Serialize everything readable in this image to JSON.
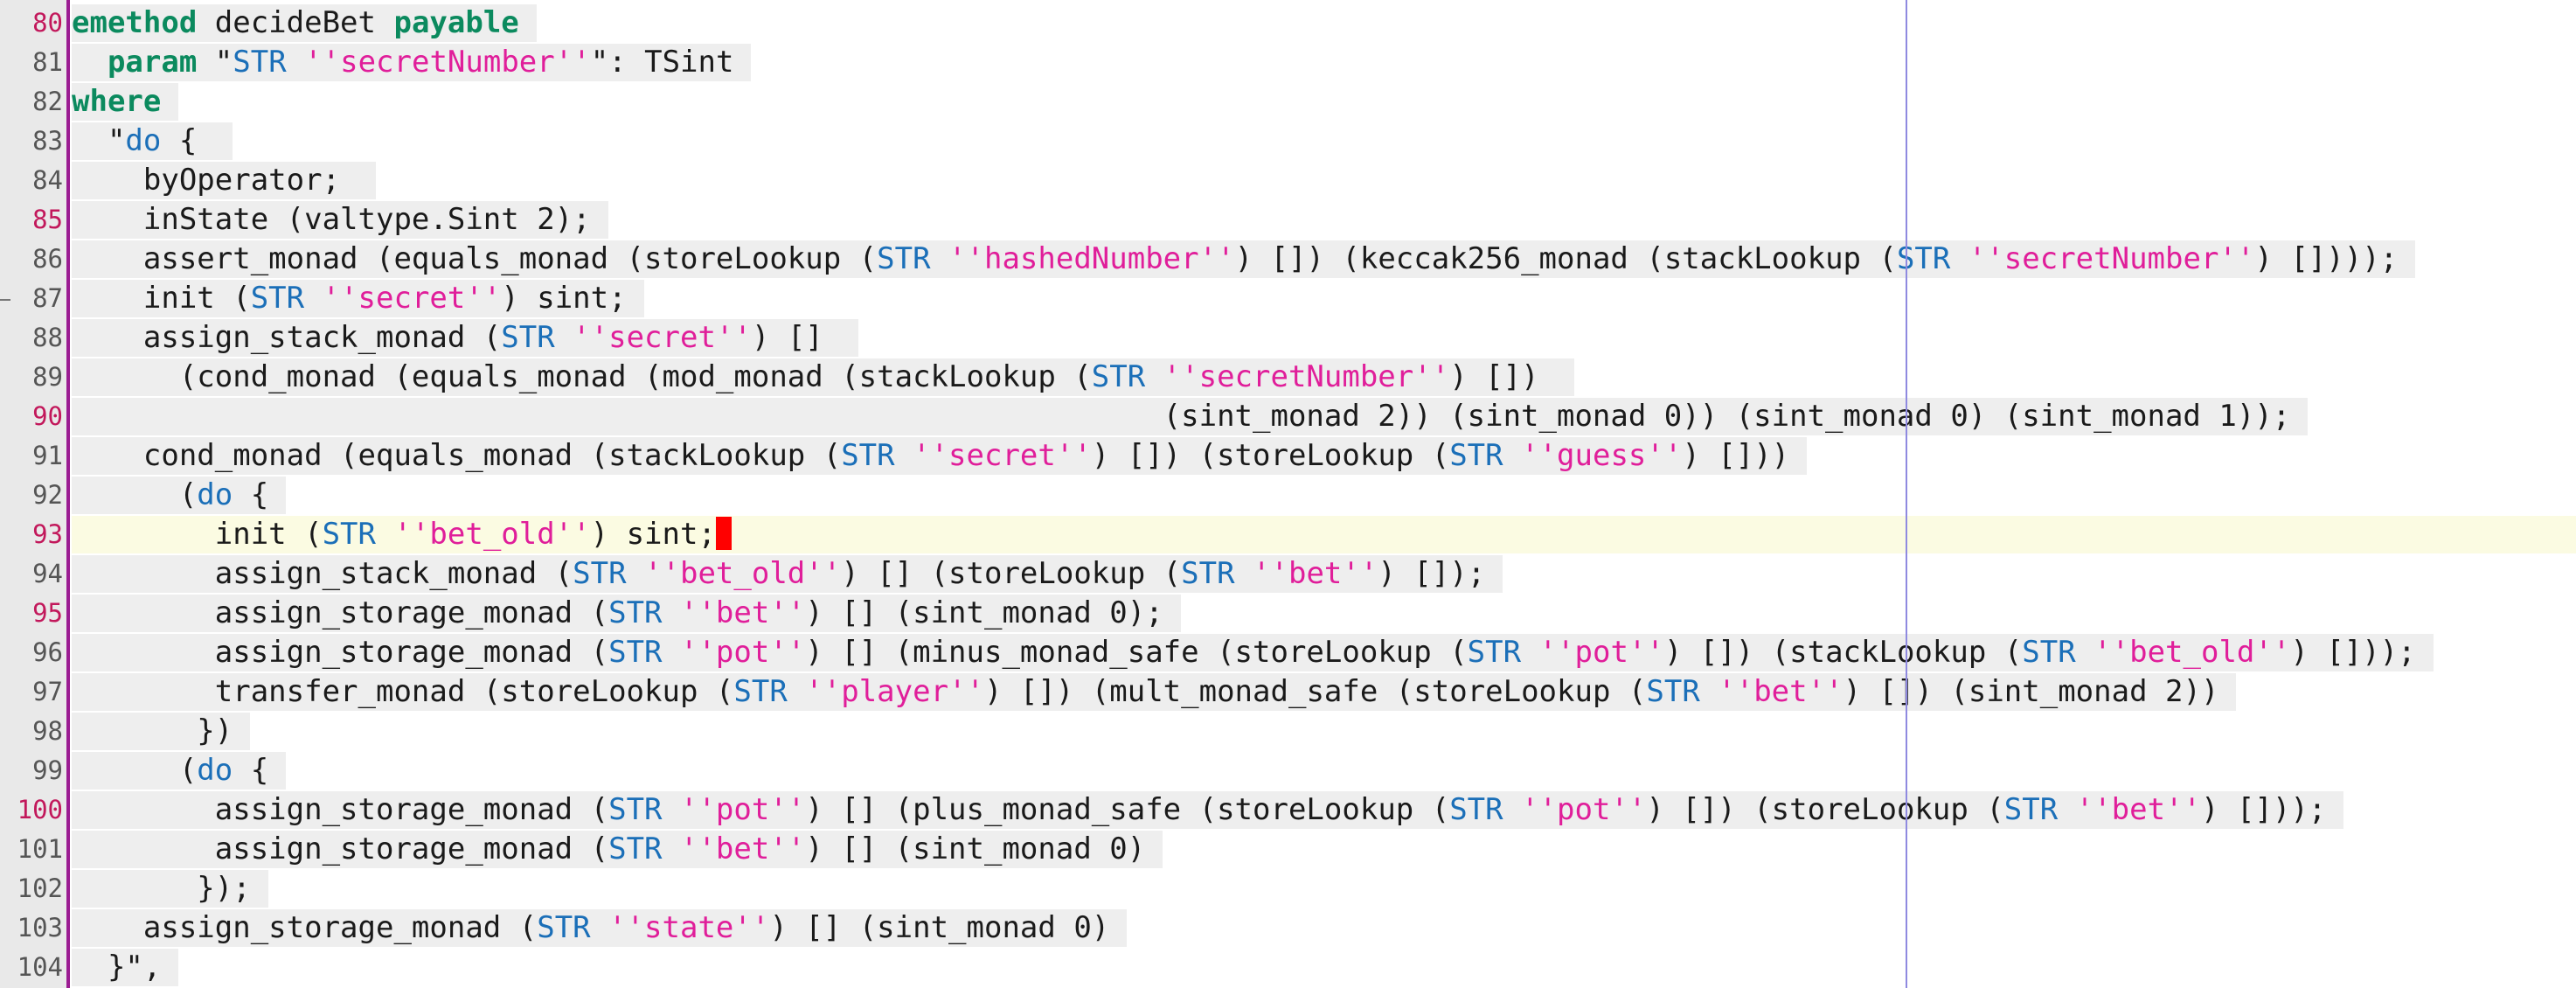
{
  "editor": {
    "current_line": "93",
    "lines": [
      {
        "num": "80",
        "tokens": [
          [
            "kw",
            "emethod"
          ],
          [
            "fn",
            " decideBet "
          ],
          [
            "kw",
            "payable"
          ]
        ]
      },
      {
        "num": "81",
        "tokens": [
          [
            "fn",
            "  "
          ],
          [
            "kw",
            "param"
          ],
          [
            "fn",
            " \""
          ],
          [
            "con",
            "STR"
          ],
          [
            "str",
            " ''secretNumber''"
          ],
          [
            "fn",
            "\": TSint"
          ]
        ]
      },
      {
        "num": "82",
        "tokens": [
          [
            "kw",
            "where"
          ]
        ]
      },
      {
        "num": "83",
        "tokens": [
          [
            "fn",
            "  \""
          ],
          [
            "con",
            "do"
          ],
          [
            "fn",
            " { "
          ]
        ]
      },
      {
        "num": "84",
        "tokens": [
          [
            "fn",
            "    byOperator; "
          ]
        ]
      },
      {
        "num": "85",
        "tokens": [
          [
            "fn",
            "    inState (valtype.Sint 2);"
          ]
        ]
      },
      {
        "num": "86",
        "tokens": [
          [
            "fn",
            "    assert_monad (equals_monad (storeLookup ("
          ],
          [
            "con",
            "STR"
          ],
          [
            "str",
            " ''hashedNumber''"
          ],
          [
            "fn",
            ") []) (keccak256_monad (stackLookup ("
          ],
          [
            "con",
            "STR"
          ],
          [
            "str",
            " ''secretNumber''"
          ],
          [
            "fn",
            ") [])));"
          ]
        ]
      },
      {
        "num": "87",
        "tokens": [
          [
            "fn",
            "    init ("
          ],
          [
            "con",
            "STR"
          ],
          [
            "str",
            " ''secret''"
          ],
          [
            "fn",
            ") sint;"
          ]
        ]
      },
      {
        "num": "88",
        "tokens": [
          [
            "fn",
            "    assign_stack_monad ("
          ],
          [
            "con",
            "STR"
          ],
          [
            "str",
            " ''secret''"
          ],
          [
            "fn",
            ") [] "
          ]
        ]
      },
      {
        "num": "89",
        "tokens": [
          [
            "fn",
            "      (cond_monad (equals_monad (mod_monad (stackLookup ("
          ],
          [
            "con",
            "STR"
          ],
          [
            "str",
            " ''secretNumber''"
          ],
          [
            "fn",
            ") []) "
          ]
        ]
      },
      {
        "num": "90",
        "tokens": [
          [
            "fn",
            "                                                             (sint_monad 2)) (sint_monad 0)) (sint_monad 0) (sint_monad 1));"
          ]
        ]
      },
      {
        "num": "91",
        "tokens": [
          [
            "fn",
            "    cond_monad (equals_monad (stackLookup ("
          ],
          [
            "con",
            "STR"
          ],
          [
            "str",
            " ''secret''"
          ],
          [
            "fn",
            ") []) (storeLookup ("
          ],
          [
            "con",
            "STR"
          ],
          [
            "str",
            " ''guess''"
          ],
          [
            "fn",
            ") []))"
          ]
        ]
      },
      {
        "num": "92",
        "tokens": [
          [
            "fn",
            "      ("
          ],
          [
            "con",
            "do"
          ],
          [
            "fn",
            " {"
          ]
        ]
      },
      {
        "num": "93",
        "tokens": [
          [
            "fn",
            "        init ("
          ],
          [
            "con",
            "STR"
          ],
          [
            "str",
            " ''bet_old''"
          ],
          [
            "fn",
            ") sint;"
          ]
        ]
      },
      {
        "num": "94",
        "tokens": [
          [
            "fn",
            "        assign_stack_monad ("
          ],
          [
            "con",
            "STR"
          ],
          [
            "str",
            " ''bet_old''"
          ],
          [
            "fn",
            ") [] (storeLookup ("
          ],
          [
            "con",
            "STR"
          ],
          [
            "str",
            " ''bet''"
          ],
          [
            "fn",
            ") []);"
          ]
        ]
      },
      {
        "num": "95",
        "tokens": [
          [
            "fn",
            "        assign_storage_monad ("
          ],
          [
            "con",
            "STR"
          ],
          [
            "str",
            " ''bet''"
          ],
          [
            "fn",
            ") [] (sint_monad 0);"
          ]
        ]
      },
      {
        "num": "96",
        "tokens": [
          [
            "fn",
            "        assign_storage_monad ("
          ],
          [
            "con",
            "STR"
          ],
          [
            "str",
            " ''pot''"
          ],
          [
            "fn",
            ") [] (minus_monad_safe (storeLookup ("
          ],
          [
            "con",
            "STR"
          ],
          [
            "str",
            " ''pot''"
          ],
          [
            "fn",
            ") []) (stackLookup ("
          ],
          [
            "con",
            "STR"
          ],
          [
            "str",
            " ''bet_old''"
          ],
          [
            "fn",
            ") []));"
          ]
        ]
      },
      {
        "num": "97",
        "tokens": [
          [
            "fn",
            "        transfer_monad (storeLookup ("
          ],
          [
            "con",
            "STR"
          ],
          [
            "str",
            " ''player''"
          ],
          [
            "fn",
            ") []) (mult_monad_safe (storeLookup ("
          ],
          [
            "con",
            "STR"
          ],
          [
            "str",
            " ''bet''"
          ],
          [
            "fn",
            ") []) (sint_monad 2))"
          ]
        ]
      },
      {
        "num": "98",
        "tokens": [
          [
            "fn",
            "       })"
          ]
        ]
      },
      {
        "num": "99",
        "tokens": [
          [
            "fn",
            "      ("
          ],
          [
            "con",
            "do"
          ],
          [
            "fn",
            " {"
          ]
        ]
      },
      {
        "num": "100",
        "tokens": [
          [
            "fn",
            "        assign_storage_monad ("
          ],
          [
            "con",
            "STR"
          ],
          [
            "str",
            " ''pot''"
          ],
          [
            "fn",
            ") [] (plus_monad_safe (storeLookup ("
          ],
          [
            "con",
            "STR"
          ],
          [
            "str",
            " ''pot''"
          ],
          [
            "fn",
            ") []) (storeLookup ("
          ],
          [
            "con",
            "STR"
          ],
          [
            "str",
            " ''bet''"
          ],
          [
            "fn",
            ") []));"
          ]
        ]
      },
      {
        "num": "101",
        "tokens": [
          [
            "fn",
            "        assign_storage_monad ("
          ],
          [
            "con",
            "STR"
          ],
          [
            "str",
            " ''bet''"
          ],
          [
            "fn",
            ") [] (sint_monad 0)"
          ]
        ]
      },
      {
        "num": "102",
        "tokens": [
          [
            "fn",
            "       });"
          ]
        ]
      },
      {
        "num": "103",
        "tokens": [
          [
            "fn",
            "    assign_storage_monad ("
          ],
          [
            "con",
            "STR"
          ],
          [
            "str",
            " ''state''"
          ],
          [
            "fn",
            ") [] (sint_monad 0)"
          ]
        ]
      },
      {
        "num": "104",
        "tokens": [
          [
            "fn",
            "  }\","
          ]
        ]
      }
    ],
    "highlighted_line_numbers": [
      "80",
      "85",
      "90",
      "93",
      "95",
      "100"
    ],
    "colors": {
      "keyword": "#0b8a5e",
      "string": "#e01e9a",
      "constructor": "#1b6fb8",
      "caret": "#ff0000",
      "current_line_bg": "#fbfbe2",
      "gutter_border": "#9b1c92"
    }
  }
}
